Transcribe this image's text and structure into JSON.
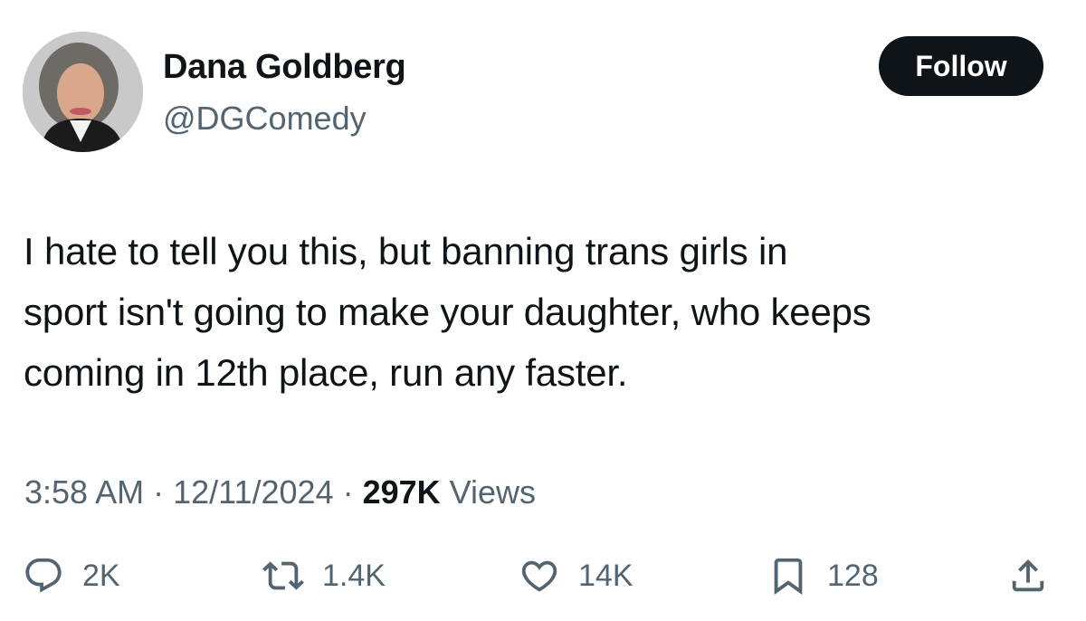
{
  "author": {
    "name": "Dana Goldberg",
    "handle": "@DGComedy"
  },
  "follow_label": "Follow",
  "tweet": {
    "text": "I hate to tell you this, but banning trans girls in\nsport isn't going to make your daughter, who keeps\ncoming in 12th place, run any faster."
  },
  "meta": {
    "time": "3:58 AM",
    "sep1": " · ",
    "date": "12/11/2024",
    "sep2": " · ",
    "views_count": "297K",
    "views_label": " Views"
  },
  "actions": {
    "replies": "2K",
    "reposts": "1.4K",
    "likes": "14K",
    "bookmarks": "128"
  },
  "colors": {
    "text": "#0f1419",
    "secondary": "#536471",
    "button_bg": "#0f1419"
  },
  "icons": [
    "reply-icon",
    "retweet-icon",
    "like-icon",
    "bookmark-icon",
    "share-icon"
  ]
}
